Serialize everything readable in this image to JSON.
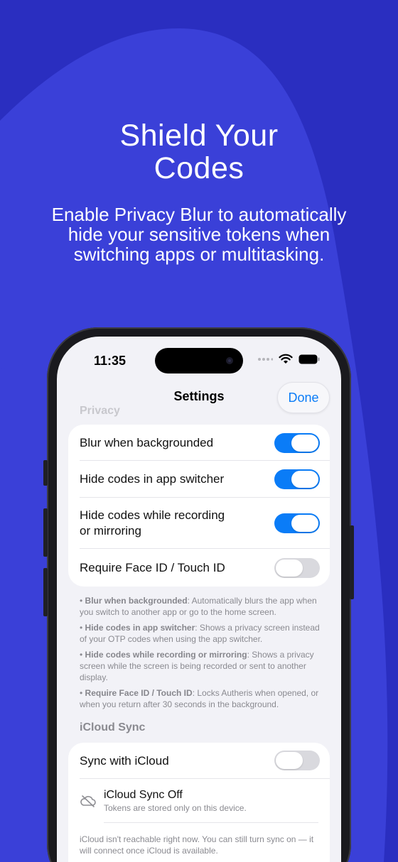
{
  "marketing": {
    "headline_line1": "Shield Your",
    "headline_line2": "Codes",
    "subhead": "Enable Privacy Blur to automatically hide your sensitive tokens when switching apps or multitasking."
  },
  "status_bar": {
    "time": "11:35"
  },
  "navbar": {
    "ghost_section": "Privacy",
    "title": "Settings",
    "done_label": "Done"
  },
  "privacy": {
    "rows": [
      {
        "label": "Blur when backgrounded",
        "on": true
      },
      {
        "label": "Hide codes in app switcher",
        "on": true
      },
      {
        "label": "Hide codes while recording or mirroring",
        "on": true
      },
      {
        "label": "Require Face ID / Touch ID",
        "on": false
      }
    ],
    "notes": [
      {
        "title": "Blur when backgrounded",
        "text": ": Automatically blurs the app when you switch to another app or go to the home screen."
      },
      {
        "title": "Hide codes in app switcher",
        "text": ": Shows a privacy screen instead of your OTP codes when using the app switcher."
      },
      {
        "title": "Hide codes while recording or mirroring",
        "text": ": Shows a privacy screen while the screen is being recorded or sent to another display."
      },
      {
        "title": "Require Face ID / Touch ID",
        "text": ": Locks Autheris when opened, or when you return after 30 seconds in the background."
      }
    ]
  },
  "icloud": {
    "section_title": "iCloud Sync",
    "sync_label": "Sync with iCloud",
    "sync_on": false,
    "status_title": "iCloud Sync Off",
    "status_subtitle": "Tokens are stored only on this device.",
    "note": "iCloud isn't reachable right now. You can still turn sync on — it will connect once iCloud is available."
  },
  "colors": {
    "background_top": "#2b2fc4",
    "background_bottom": "#3a3fd6",
    "accent": "#0a7cf7",
    "toggle_off": "#d9d9de"
  }
}
